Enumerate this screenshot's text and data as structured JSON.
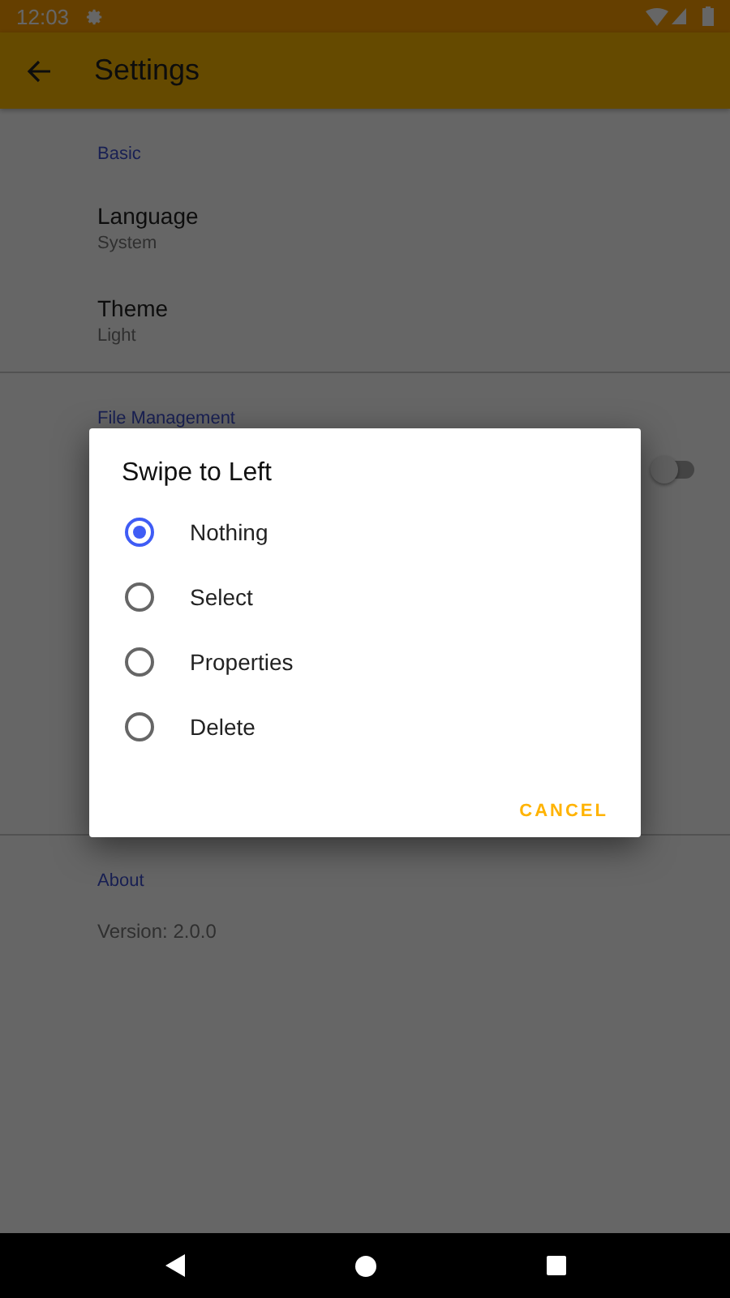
{
  "status_bar": {
    "time": "12:03"
  },
  "app_bar": {
    "title": "Settings"
  },
  "sections": [
    {
      "kind": "items",
      "title": "Basic",
      "items": [
        {
          "label": "Language",
          "value": "System"
        },
        {
          "label": "Theme",
          "value": "Light"
        }
      ]
    },
    {
      "kind": "toggle",
      "title": "File Management",
      "switch": {
        "on": false
      }
    },
    {
      "kind": "text",
      "title": "About",
      "text": "Version: 2.0.0"
    }
  ],
  "dialog": {
    "title": "Swipe to Left",
    "options": [
      {
        "label": "Nothing",
        "selected": true
      },
      {
        "label": "Select",
        "selected": false
      },
      {
        "label": "Properties",
        "selected": false
      },
      {
        "label": "Delete",
        "selected": false
      }
    ],
    "button": "CANCEL"
  }
}
